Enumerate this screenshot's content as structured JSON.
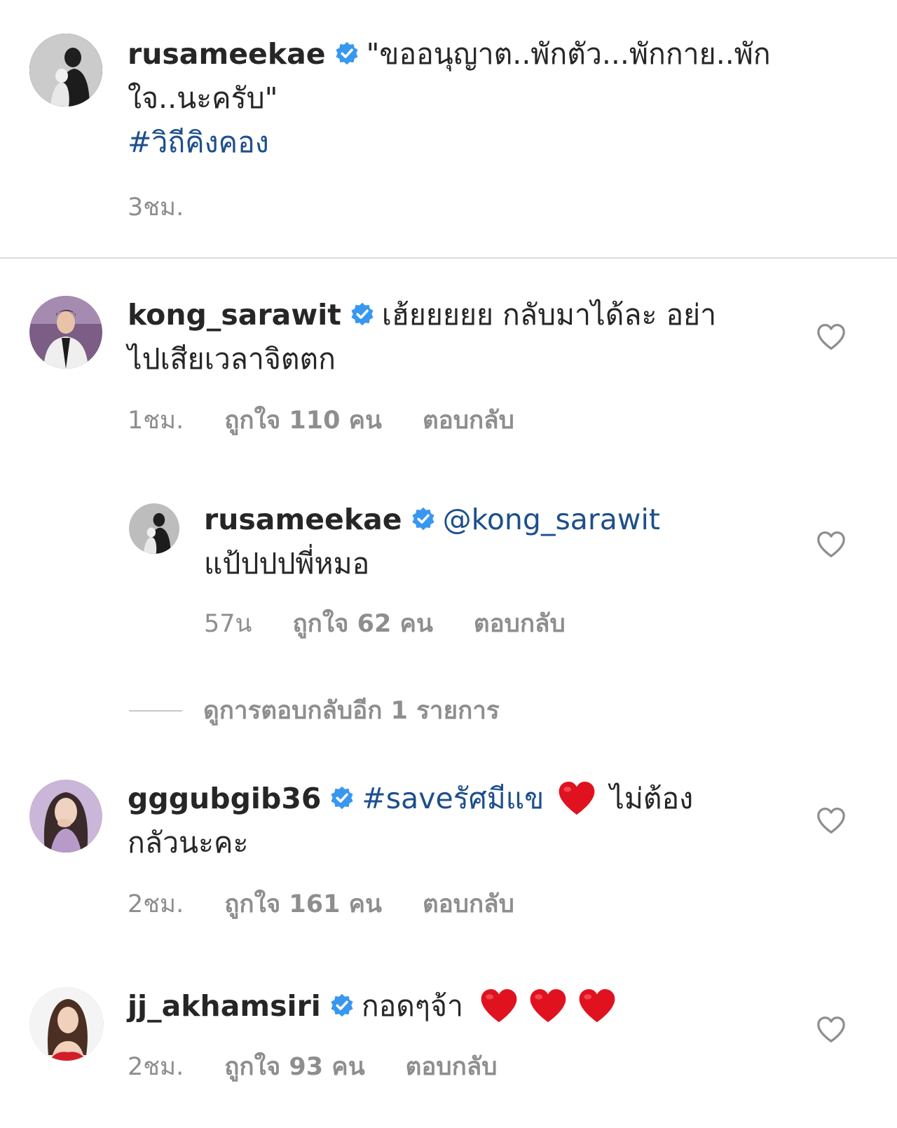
{
  "caption": {
    "username": "rusameekae",
    "text_line1": "\"ขออนุญาต..พักตัว...พักกาย..พัก",
    "text_line2": "ใจ..นะครับ\"",
    "hashtag": "#วิถีคิงคอง",
    "time": "3ชม."
  },
  "comments": [
    {
      "username": "kong_sarawit",
      "text_line1": "เฮ้ยยยยย กลับมาได้ละ อย่า",
      "text_line2": "ไปเสียเวลาจิตตก",
      "time": "1ชม.",
      "likes": "ถูกใจ 110 คน",
      "reply": "ตอบกลับ"
    },
    {
      "username": "rusameekae",
      "mention": "@kong_sarawit",
      "text_line2": "แป้ปปปพี่หมอ",
      "time": "57น",
      "likes": "ถูกใจ 62 คน",
      "reply": "ตอบกลับ"
    },
    {
      "username": "gggubgib36",
      "hashtag": "#saveรัศมีแข",
      "text_after": "ไม่ต้อง",
      "text_line2": "กลัวนะคะ",
      "time": "2ชม.",
      "likes": "ถูกใจ 161 คน",
      "reply": "ตอบกลับ"
    },
    {
      "username": "jj_akhamsiri",
      "text_line1": "กอดๆจ้า",
      "time": "2ชม.",
      "likes": "ถูกใจ 93 คน",
      "reply": "ตอบกลับ"
    }
  ],
  "view_more_replies": "ดูการตอบกลับอีก 1 รายการ",
  "colors": {
    "verified": "#3897f0",
    "link": "#1d4f8c",
    "heart": "#e0121f",
    "meta": "#8e8e8e"
  },
  "icons": [
    "verified-badge-icon",
    "heart-outline-icon",
    "red-heart-emoji"
  ]
}
